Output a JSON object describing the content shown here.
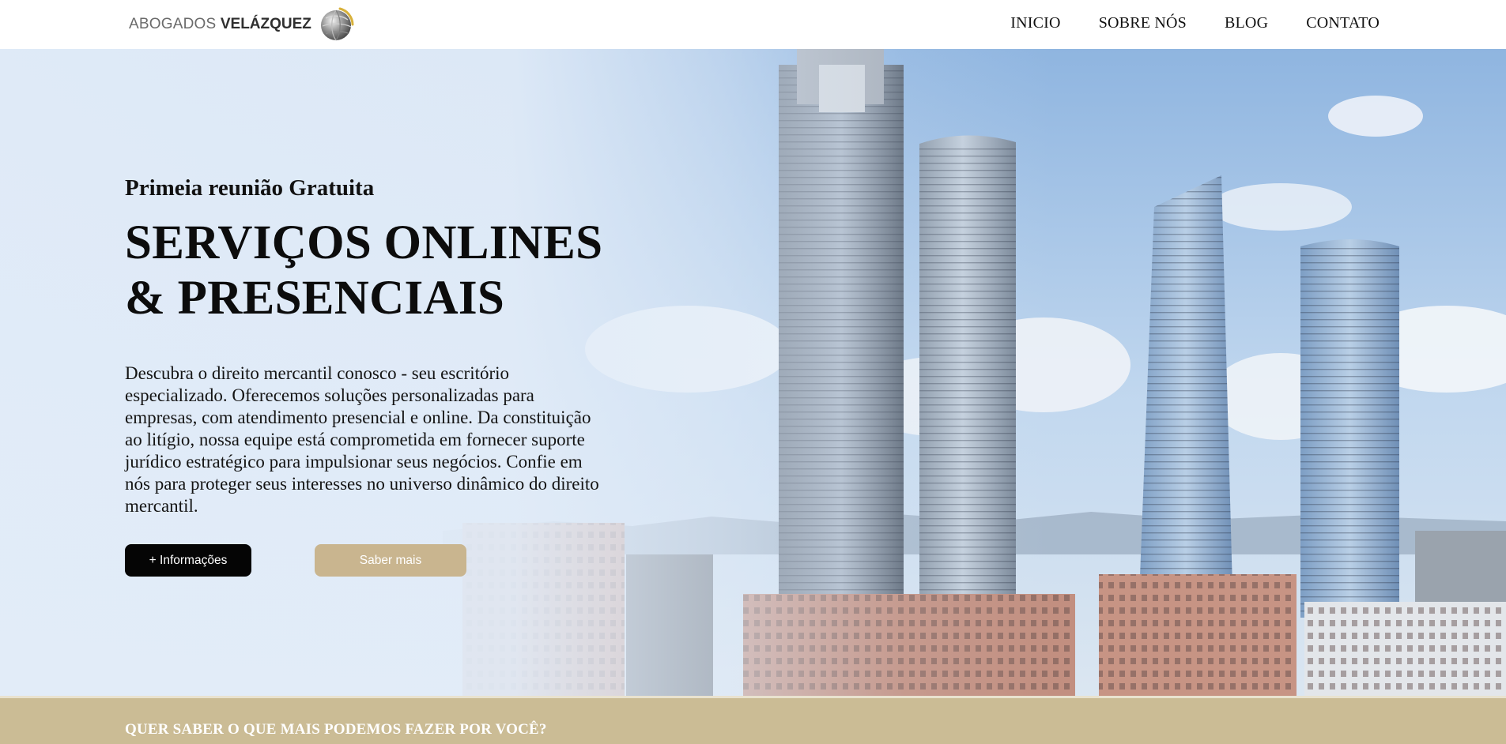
{
  "brand": {
    "name_light": "ABOGADOS",
    "name_bold": "VELÁZQUEZ"
  },
  "nav": {
    "items": [
      {
        "label": "INICIO"
      },
      {
        "label": "SOBRE NÓS"
      },
      {
        "label": "BLOG"
      },
      {
        "label": "CONTATO"
      }
    ]
  },
  "hero": {
    "eyebrow": "Primeia reunião Gratuita",
    "headline_line1": "SERVIÇOS ONLINES",
    "headline_line2": "& PRESENCIAIS",
    "description": "Descubra o direito mercantil conosco - seu escritório especializado. Oferecemos soluções personalizadas para empresas, com atendimento presencial e online. Da constituição ao litígio, nossa equipe está comprometida em fornecer suporte jurídico estratégico para impulsionar seus negócios. Confie em nós para proteger seus interesses no universo dinâmico do direito mercantil.",
    "primary_button": "+ Informações",
    "secondary_button": "Saber mais"
  },
  "strip": {
    "text": "QUER SABER O QUE MAIS PODEMOS FAZER POR VOCÊ?"
  },
  "colors": {
    "gold": "#c9b58f",
    "strip": "#cbbc95",
    "dark_button": "#050505",
    "sky": "#a9c7e8"
  },
  "icons": {
    "logo": "globe-icon"
  }
}
